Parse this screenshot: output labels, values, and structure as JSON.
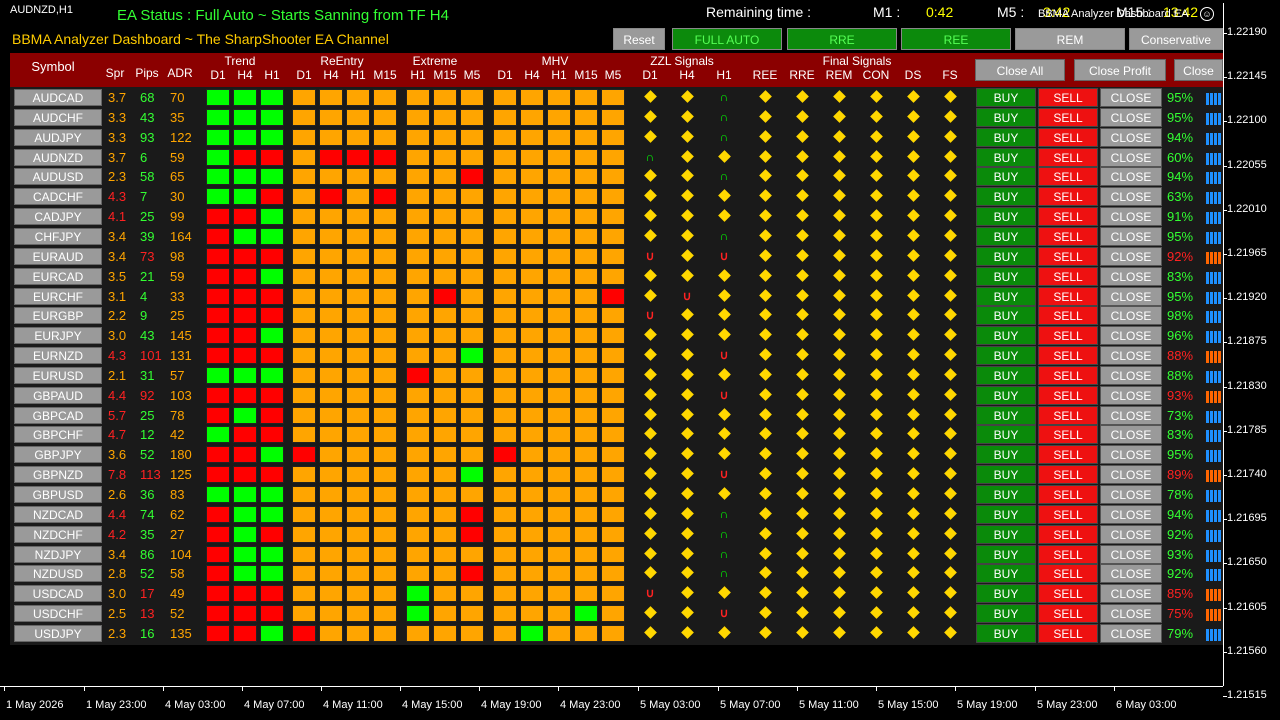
{
  "chart_symbol": "AUDNZD,H1",
  "status_text": "EA Status : Full Auto ~ Starts Sanning from TF H4",
  "remaining_label": "Remaining time :",
  "timers": {
    "m1_label": "M1 :",
    "m1": "0:42",
    "m5_label": "M5 :",
    "m5": "3:42",
    "m15_label": "M15 :",
    "m15": "13:42"
  },
  "ea_name": "BBMA Analyzer Dashboard EA",
  "subtitle": "BBMA Analyzer Dashboard ~ The SharpShooter EA Channel",
  "top_buttons": [
    "Reset",
    "FULL AUTO",
    "RRE",
    "REE",
    "REM",
    "Conservative"
  ],
  "headers": {
    "symbol": "Symbol",
    "spr": "Spr",
    "pips": "Pips",
    "adr": "ADR",
    "trend": "Trend",
    "reentry": "ReEntry",
    "extreme": "Extreme",
    "mhv": "MHV",
    "zzl": "ZZL Signals",
    "final": "Final Signals",
    "trend_tf": [
      "D1",
      "H4",
      "H1"
    ],
    "reentry_tf": [
      "D1",
      "H4",
      "H1",
      "M15"
    ],
    "extreme_tf": [
      "H1",
      "M15",
      "M5"
    ],
    "mhv_tf": [
      "D1",
      "H4",
      "H1",
      "M15",
      "M5"
    ],
    "zzl_tf": [
      "D1",
      "H4",
      "H1"
    ],
    "final_cols": [
      "REE",
      "RRE",
      "REM",
      "CON",
      "DS",
      "FS"
    ]
  },
  "controls": [
    "Close All",
    "Close Profit",
    "Close"
  ],
  "row_buttons": {
    "buy": "BUY",
    "sell": "SELL",
    "close": "CLOSE"
  },
  "colors": {
    "green": "#00ff00",
    "red": "#ff0000",
    "orange": "#ffa500",
    "up": "#00ff00",
    "down": "#ff2222",
    "buy_bar": "#1e90ff",
    "sell_bar": "#ff6600"
  },
  "rows": [
    {
      "sym": "AUDCAD",
      "spr": "3.7",
      "pips": "68",
      "adr": "70",
      "sc": "o",
      "pc": "g",
      "trend": "ggg",
      "reentry": "oooo",
      "extreme": "ooo",
      "mhv": "ooooo",
      "zzl": "ddu",
      "pct": "95%",
      "dir": "b"
    },
    {
      "sym": "AUDCHF",
      "spr": "3.3",
      "pips": "43",
      "adr": "35",
      "sc": "o",
      "pc": "g",
      "trend": "ggg",
      "reentry": "oooo",
      "extreme": "ooo",
      "mhv": "ooooo",
      "zzl": "ddu",
      "pct": "95%",
      "dir": "b"
    },
    {
      "sym": "AUDJPY",
      "spr": "3.3",
      "pips": "93",
      "adr": "122",
      "sc": "o",
      "pc": "g",
      "trend": "ggg",
      "reentry": "oooo",
      "extreme": "ooo",
      "mhv": "ooooo",
      "zzl": "ddu",
      "pct": "94%",
      "dir": "b"
    },
    {
      "sym": "AUDNZD",
      "spr": "3.7",
      "pips": "6",
      "adr": "59",
      "sc": "o",
      "pc": "g",
      "trend": "grr",
      "reentry": "orrr",
      "extreme": "ooo",
      "mhv": "ooooo",
      "zzl": "udd",
      "pct": "60%",
      "dir": "b"
    },
    {
      "sym": "AUDUSD",
      "spr": "2.3",
      "pips": "58",
      "adr": "65",
      "sc": "o",
      "pc": "g",
      "trend": "ggg",
      "reentry": "oooo",
      "extreme": "oor",
      "mhv": "ooooo",
      "zzl": "ddu",
      "pct": "94%",
      "dir": "b"
    },
    {
      "sym": "CADCHF",
      "spr": "4.3",
      "pips": "7",
      "adr": "30",
      "sc": "r",
      "pc": "g",
      "trend": "ggr",
      "reentry": "oror",
      "extreme": "ooo",
      "mhv": "ooooo",
      "zzl": "ddd",
      "pct": "63%",
      "dir": "b"
    },
    {
      "sym": "CADJPY",
      "spr": "4.1",
      "pips": "25",
      "adr": "99",
      "sc": "r",
      "pc": "g",
      "trend": "rrg",
      "reentry": "oooo",
      "extreme": "ooo",
      "mhv": "ooooo",
      "zzl": "ddd",
      "pct": "91%",
      "dir": "b"
    },
    {
      "sym": "CHFJPY",
      "spr": "3.4",
      "pips": "39",
      "adr": "164",
      "sc": "o",
      "pc": "g",
      "trend": "rgg",
      "reentry": "oooo",
      "extreme": "ooo",
      "mhv": "ooooo",
      "zzl": "ddu",
      "pct": "95%",
      "dir": "b"
    },
    {
      "sym": "EURAUD",
      "spr": "3.4",
      "pips": "73",
      "adr": "98",
      "sc": "o",
      "pc": "r",
      "trend": "rrr",
      "reentry": "oooo",
      "extreme": "ooo",
      "mhv": "ooooo",
      "zzl": "Ddr",
      "pct": "92%",
      "dir": "s"
    },
    {
      "sym": "EURCAD",
      "spr": "3.5",
      "pips": "21",
      "adr": "59",
      "sc": "o",
      "pc": "g",
      "trend": "rrg",
      "reentry": "oooo",
      "extreme": "ooo",
      "mhv": "ooooo",
      "zzl": "ddd",
      "pct": "83%",
      "dir": "b"
    },
    {
      "sym": "EURCHF",
      "spr": "3.1",
      "pips": "4",
      "adr": "33",
      "sc": "o",
      "pc": "g",
      "trend": "rrr",
      "reentry": "oooo",
      "extreme": "oro",
      "mhv": "oooor",
      "zzl": "drd",
      "pct": "95%",
      "dir": "b"
    },
    {
      "sym": "EURGBP",
      "spr": "2.2",
      "pips": "9",
      "adr": "25",
      "sc": "o",
      "pc": "g",
      "trend": "rrr",
      "reentry": "oooo",
      "extreme": "ooo",
      "mhv": "ooooo",
      "zzl": "Rdd",
      "pct": "98%",
      "dir": "b"
    },
    {
      "sym": "EURJPY",
      "spr": "3.0",
      "pips": "43",
      "adr": "145",
      "sc": "o",
      "pc": "g",
      "trend": "rrg",
      "reentry": "oooo",
      "extreme": "ooo",
      "mhv": "ooooo",
      "zzl": "ddd",
      "pct": "96%",
      "dir": "b"
    },
    {
      "sym": "EURNZD",
      "spr": "4.3",
      "pips": "101",
      "adr": "131",
      "sc": "r",
      "pc": "r",
      "trend": "rrr",
      "reentry": "oooo",
      "extreme": "oog",
      "mhv": "ooooo",
      "zzl": "ddr",
      "pct": "88%",
      "dir": "s"
    },
    {
      "sym": "EURUSD",
      "spr": "2.1",
      "pips": "31",
      "adr": "57",
      "sc": "o",
      "pc": "g",
      "trend": "ggg",
      "reentry": "oooo",
      "extreme": "roo",
      "mhv": "ooooo",
      "zzl": "ddd",
      "pct": "88%",
      "dir": "b"
    },
    {
      "sym": "GBPAUD",
      "spr": "4.4",
      "pips": "92",
      "adr": "103",
      "sc": "r",
      "pc": "r",
      "trend": "rrr",
      "reentry": "oooo",
      "extreme": "ooo",
      "mhv": "ooooo",
      "zzl": "ddr",
      "pct": "93%",
      "dir": "s"
    },
    {
      "sym": "GBPCAD",
      "spr": "5.7",
      "pips": "25",
      "adr": "78",
      "sc": "r",
      "pc": "g",
      "trend": "rgr",
      "reentry": "oooo",
      "extreme": "ooo",
      "mhv": "ooooo",
      "zzl": "ddd",
      "pct": "73%",
      "dir": "b"
    },
    {
      "sym": "GBPCHF",
      "spr": "4.7",
      "pips": "12",
      "adr": "42",
      "sc": "r",
      "pc": "g",
      "trend": "grr",
      "reentry": "oooo",
      "extreme": "ooo",
      "mhv": "ooooo",
      "zzl": "ddd",
      "pct": "83%",
      "dir": "b"
    },
    {
      "sym": "GBPJPY",
      "spr": "3.6",
      "pips": "52",
      "adr": "180",
      "sc": "o",
      "pc": "g",
      "trend": "rrg",
      "reentry": "rooo",
      "extreme": "ooo",
      "mhv": "roooo",
      "zzl": "ddd",
      "pct": "95%",
      "dir": "b"
    },
    {
      "sym": "GBPNZD",
      "spr": "7.8",
      "pips": "113",
      "adr": "125",
      "sc": "r",
      "pc": "r",
      "trend": "rrr",
      "reentry": "oooo",
      "extreme": "oog",
      "mhv": "ooooo",
      "zzl": "ddr",
      "pct": "89%",
      "dir": "s"
    },
    {
      "sym": "GBPUSD",
      "spr": "2.6",
      "pips": "36",
      "adr": "83",
      "sc": "o",
      "pc": "g",
      "trend": "ggg",
      "reentry": "oooo",
      "extreme": "ooo",
      "mhv": "ooooo",
      "zzl": "ddd",
      "pct": "78%",
      "dir": "b"
    },
    {
      "sym": "NZDCAD",
      "spr": "4.4",
      "pips": "74",
      "adr": "62",
      "sc": "r",
      "pc": "g",
      "trend": "rgg",
      "reentry": "oooo",
      "extreme": "oor",
      "mhv": "ooooo",
      "zzl": "ddu",
      "pct": "94%",
      "dir": "b"
    },
    {
      "sym": "NZDCHF",
      "spr": "4.2",
      "pips": "35",
      "adr": "27",
      "sc": "r",
      "pc": "g",
      "trend": "rgr",
      "reentry": "oooo",
      "extreme": "oor",
      "mhv": "ooooo",
      "zzl": "ddu",
      "pct": "92%",
      "dir": "b"
    },
    {
      "sym": "NZDJPY",
      "spr": "3.4",
      "pips": "86",
      "adr": "104",
      "sc": "o",
      "pc": "g",
      "trend": "rgg",
      "reentry": "oooo",
      "extreme": "ooo",
      "mhv": "ooooo",
      "zzl": "ddu",
      "pct": "93%",
      "dir": "b"
    },
    {
      "sym": "NZDUSD",
      "spr": "2.8",
      "pips": "52",
      "adr": "58",
      "sc": "o",
      "pc": "g",
      "trend": "rgg",
      "reentry": "oooo",
      "extreme": "oor",
      "mhv": "ooooo",
      "zzl": "ddu",
      "pct": "92%",
      "dir": "b"
    },
    {
      "sym": "USDCAD",
      "spr": "3.0",
      "pips": "17",
      "adr": "49",
      "sc": "o",
      "pc": "r",
      "trend": "rrr",
      "reentry": "oooo",
      "extreme": "goo",
      "mhv": "ooooo",
      "zzl": "Rdd",
      "pct": "85%",
      "dir": "s"
    },
    {
      "sym": "USDCHF",
      "spr": "2.5",
      "pips": "13",
      "adr": "52",
      "sc": "o",
      "pc": "r",
      "trend": "rrr",
      "reentry": "oooo",
      "extreme": "goo",
      "mhv": "oooGo",
      "zzl": "ddr",
      "pct": "75%",
      "dir": "s"
    },
    {
      "sym": "USDJPY",
      "spr": "2.3",
      "pips": "16",
      "adr": "135",
      "sc": "o",
      "pc": "g",
      "trend": "rrg",
      "reentry": "rooo",
      "extreme": "ooo",
      "mhv": "ogooo",
      "zzl": "ddd",
      "pct": "79%",
      "dir": "b"
    }
  ],
  "price_axis": [
    "1.22190",
    "1.22145",
    "1.22100",
    "1.22055",
    "1.22010",
    "1.21965",
    "1.21920",
    "1.21875",
    "1.21830",
    "1.21785",
    "1.21740",
    "1.21695",
    "1.21650",
    "1.21605",
    "1.21560",
    "1.21515"
  ],
  "time_axis": [
    "1 May 2026",
    "1 May 23:00",
    "4 May 03:00",
    "4 May 07:00",
    "4 May 11:00",
    "4 May 15:00",
    "4 May 19:00",
    "4 May 23:00",
    "5 May 03:00",
    "5 May 07:00",
    "5 May 11:00",
    "5 May 15:00",
    "5 May 19:00",
    "5 May 23:00",
    "6 May 03:00"
  ]
}
